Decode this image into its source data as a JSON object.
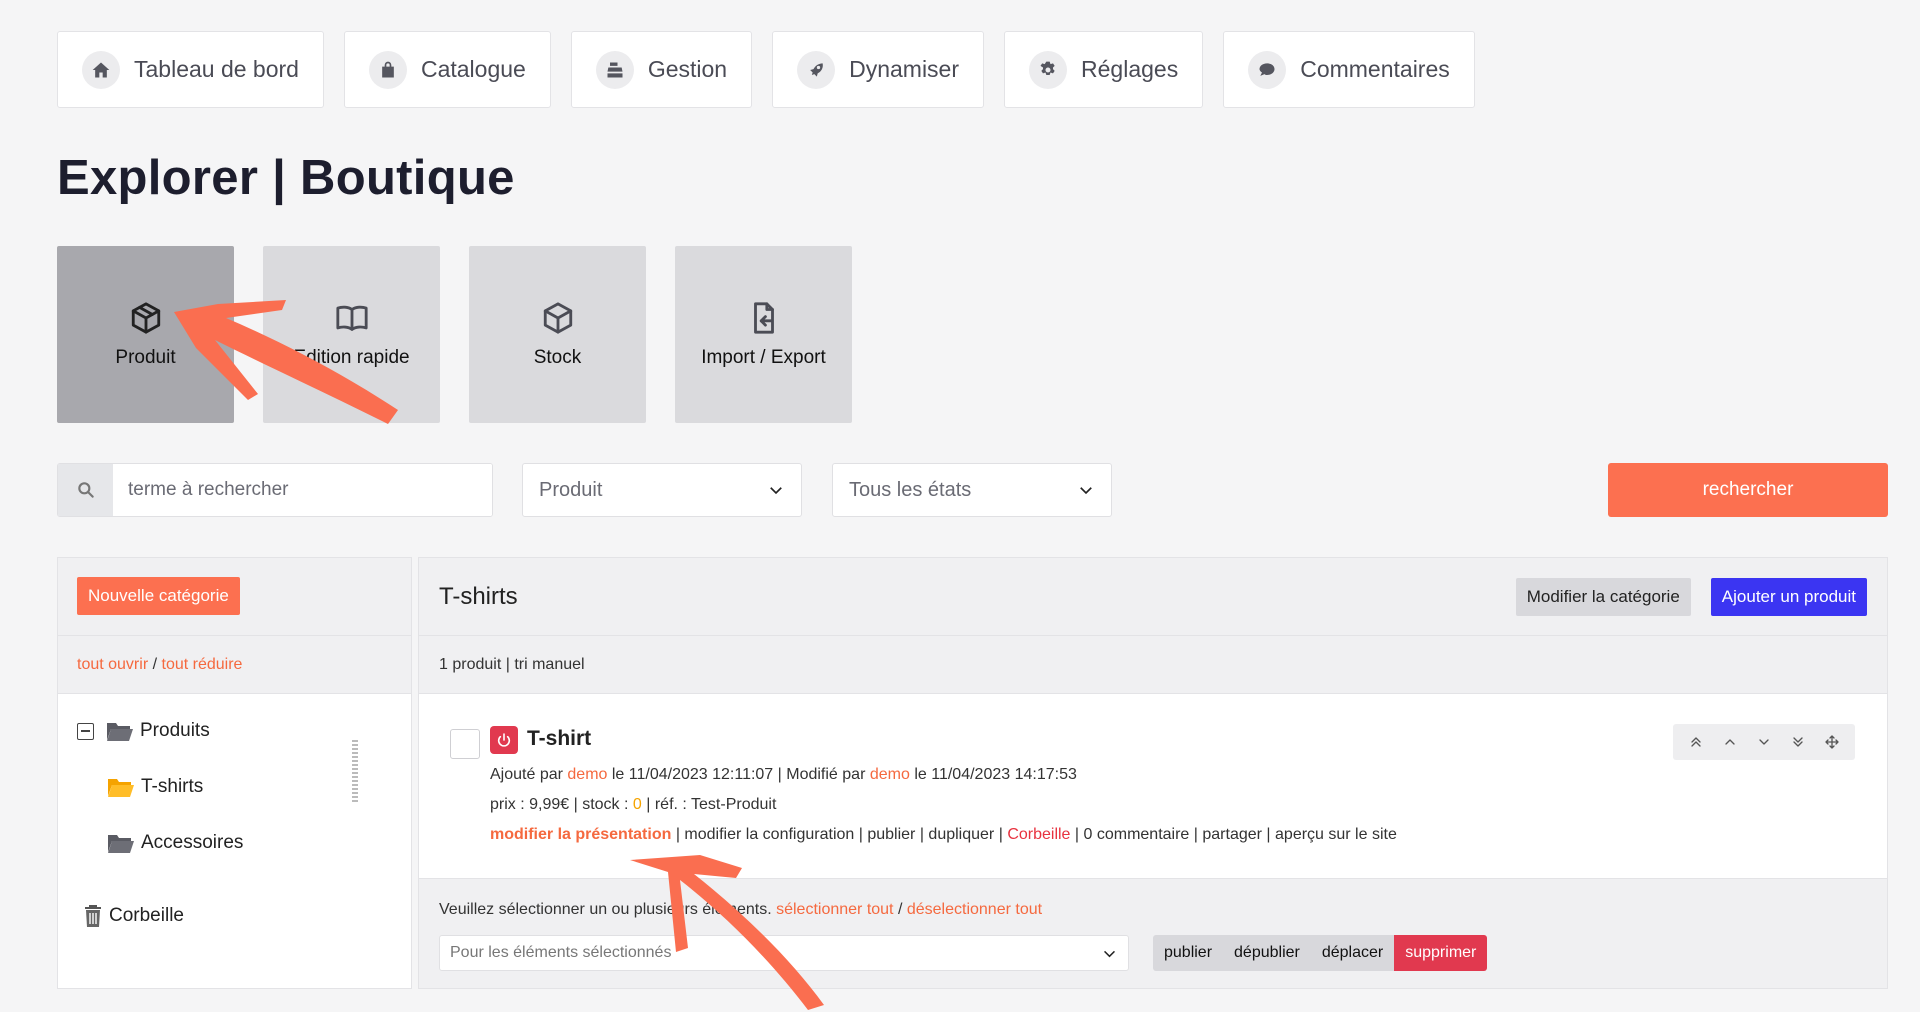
{
  "nav": [
    {
      "label": "Tableau de bord",
      "icon": "home-icon"
    },
    {
      "label": "Catalogue",
      "icon": "bag-icon"
    },
    {
      "label": "Gestion",
      "icon": "register-icon"
    },
    {
      "label": "Dynamiser",
      "icon": "rocket-icon"
    },
    {
      "label": "Réglages",
      "icon": "gear-icon"
    },
    {
      "label": "Commentaires",
      "icon": "comment-icon"
    }
  ],
  "page_title": "Explorer | Boutique",
  "tiles": [
    {
      "label": "Produit",
      "icon": "box-icon",
      "active": true
    },
    {
      "label": "Edition rapide",
      "icon": "book-icon",
      "active": false
    },
    {
      "label": "Stock",
      "icon": "box-icon",
      "active": false
    },
    {
      "label": "Import / Export",
      "icon": "file-import-icon",
      "active": false
    }
  ],
  "search": {
    "placeholder": "terme à rechercher",
    "type_select": "Produit",
    "state_select": "Tous les états",
    "button": "rechercher"
  },
  "left": {
    "new_category": "Nouvelle catégorie",
    "open_all": "tout ouvrir",
    "separator": "/",
    "collapse_all": "tout réduire",
    "tree": {
      "root": "Produits",
      "child1": "T-shirts",
      "child2": "Accessoires",
      "trash": "Corbeille"
    }
  },
  "right": {
    "category_title": "T-shirts",
    "edit_category": "Modifier la catégorie",
    "add_product": "Ajouter un produit",
    "summary": "1 produit | tri manuel",
    "product": {
      "name": "T-shirt",
      "added_by_prefix": "Ajouté par",
      "added_by": "demo",
      "added_on": "le 11/04/2023 12:11:07 | Modifié par",
      "modified_by": "demo",
      "modified_on": "le 11/04/2023 14:17:53",
      "price_prefix": "prix : 9,99€ | stock :",
      "stock": "0",
      "ref": "| réf. : Test-Produit",
      "action_edit_presentation": "modifier la présentation",
      "actions_mid": "| modifier la configuration | publier | dupliquer |",
      "action_trash": "Corbeille",
      "actions_end": "| 0 commentaire | partager | aperçu sur le site"
    },
    "footer": {
      "text": "Veuillez sélectionner un ou plusieurs éléments.",
      "select_all": "sélectionner tout",
      "separator": "/",
      "deselect_all": "déselectionner tout",
      "bulk_placeholder": "Pour les éléments sélectionnés",
      "buttons": [
        "publier",
        "dépublier",
        "déplacer",
        "supprimer"
      ]
    }
  },
  "colors": {
    "accent": "#fc7050",
    "primary": "#3b35f2",
    "danger": "#e1394f",
    "annotation": "#fa6e50"
  }
}
